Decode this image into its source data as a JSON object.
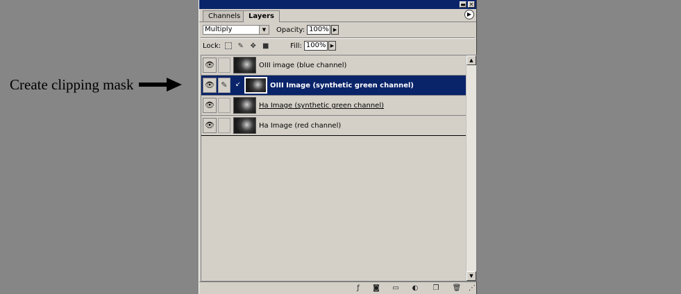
{
  "annotation": {
    "text": "Create clipping mask"
  },
  "palette": {
    "tabs": [
      {
        "label": "Channels"
      },
      {
        "label": "Layers"
      }
    ],
    "blend_mode": "Multiply",
    "opacity_label": "Opacity:",
    "opacity_value": "100%",
    "lock_label": "Lock:",
    "fill_label": "Fill:",
    "fill_value": "100%"
  },
  "layers": [
    {
      "name": "OIII image (blue channel)",
      "selected": false
    },
    {
      "name": "OIII Image (synthetic green channel)",
      "selected": true,
      "clipped": true
    },
    {
      "name": "Ha Image (synthetic green channel)",
      "selected": false,
      "underlined": true
    },
    {
      "name": "Ha Image (red channel)",
      "selected": false
    }
  ],
  "icons": {
    "visibility": "eye-icon",
    "brush": "brush-icon",
    "clip": "clipping-arrow-icon",
    "lock_transparent": "lock-transparency-icon",
    "lock_image": "lock-image-icon",
    "lock_position": "lock-position-icon",
    "lock_all": "lock-all-icon",
    "bottom": [
      "layer-style-icon",
      "add-mask-icon",
      "new-group-icon",
      "adjustment-layer-icon",
      "new-layer-icon",
      "delete-layer-icon"
    ]
  },
  "colors": {
    "desktop": "#868686",
    "panel": "#d4d0c8",
    "selection": "#0a246a"
  }
}
